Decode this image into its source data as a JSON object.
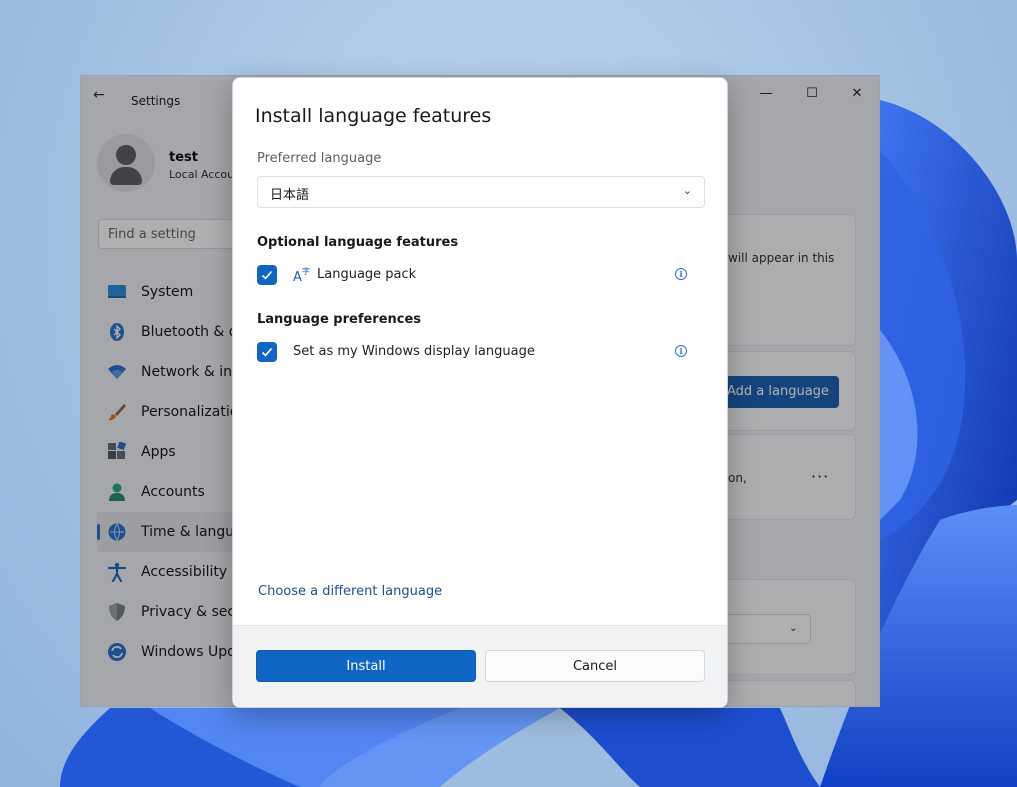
{
  "settings": {
    "app_title": "Settings",
    "window_controls": {
      "minimize": "—",
      "maximize": "☐",
      "close": "✕"
    },
    "profile": {
      "name": "test",
      "account_type": "Local Accou"
    },
    "search": {
      "placeholder": "Find a setting"
    },
    "nav_items": [
      {
        "label": "System",
        "icon": "system-icon"
      },
      {
        "label": "Bluetooth & de",
        "icon": "bluetooth-icon"
      },
      {
        "label": "Network & inte",
        "icon": "network-icon"
      },
      {
        "label": "Personalization",
        "icon": "brush-icon"
      },
      {
        "label": "Apps",
        "icon": "apps-icon"
      },
      {
        "label": "Accounts",
        "icon": "accounts-icon"
      },
      {
        "label": "Time & langua",
        "icon": "time-language-icon",
        "selected": true
      },
      {
        "label": "Accessibility",
        "icon": "accessibility-icon"
      },
      {
        "label": "Privacy & secur",
        "icon": "shield-icon"
      },
      {
        "label": "Windows Upda",
        "icon": "update-icon"
      }
    ],
    "content": {
      "card1_text": "will appear in this",
      "add_language_label": "Add a language",
      "card3_text": "on,",
      "more_icon": "···"
    }
  },
  "dialog": {
    "title": "Install language features",
    "preferred_language_label": "Preferred language",
    "preferred_language_value": "日本語",
    "optional_features_heading": "Optional language features",
    "language_pack_label": "Language pack",
    "language_preferences_heading": "Language preferences",
    "display_language_label": "Set as my Windows display language",
    "choose_link": "Choose a different language",
    "install_label": "Install",
    "cancel_label": "Cancel"
  },
  "colors": {
    "accent": "#0f66c4",
    "link": "#1b4f8f"
  }
}
